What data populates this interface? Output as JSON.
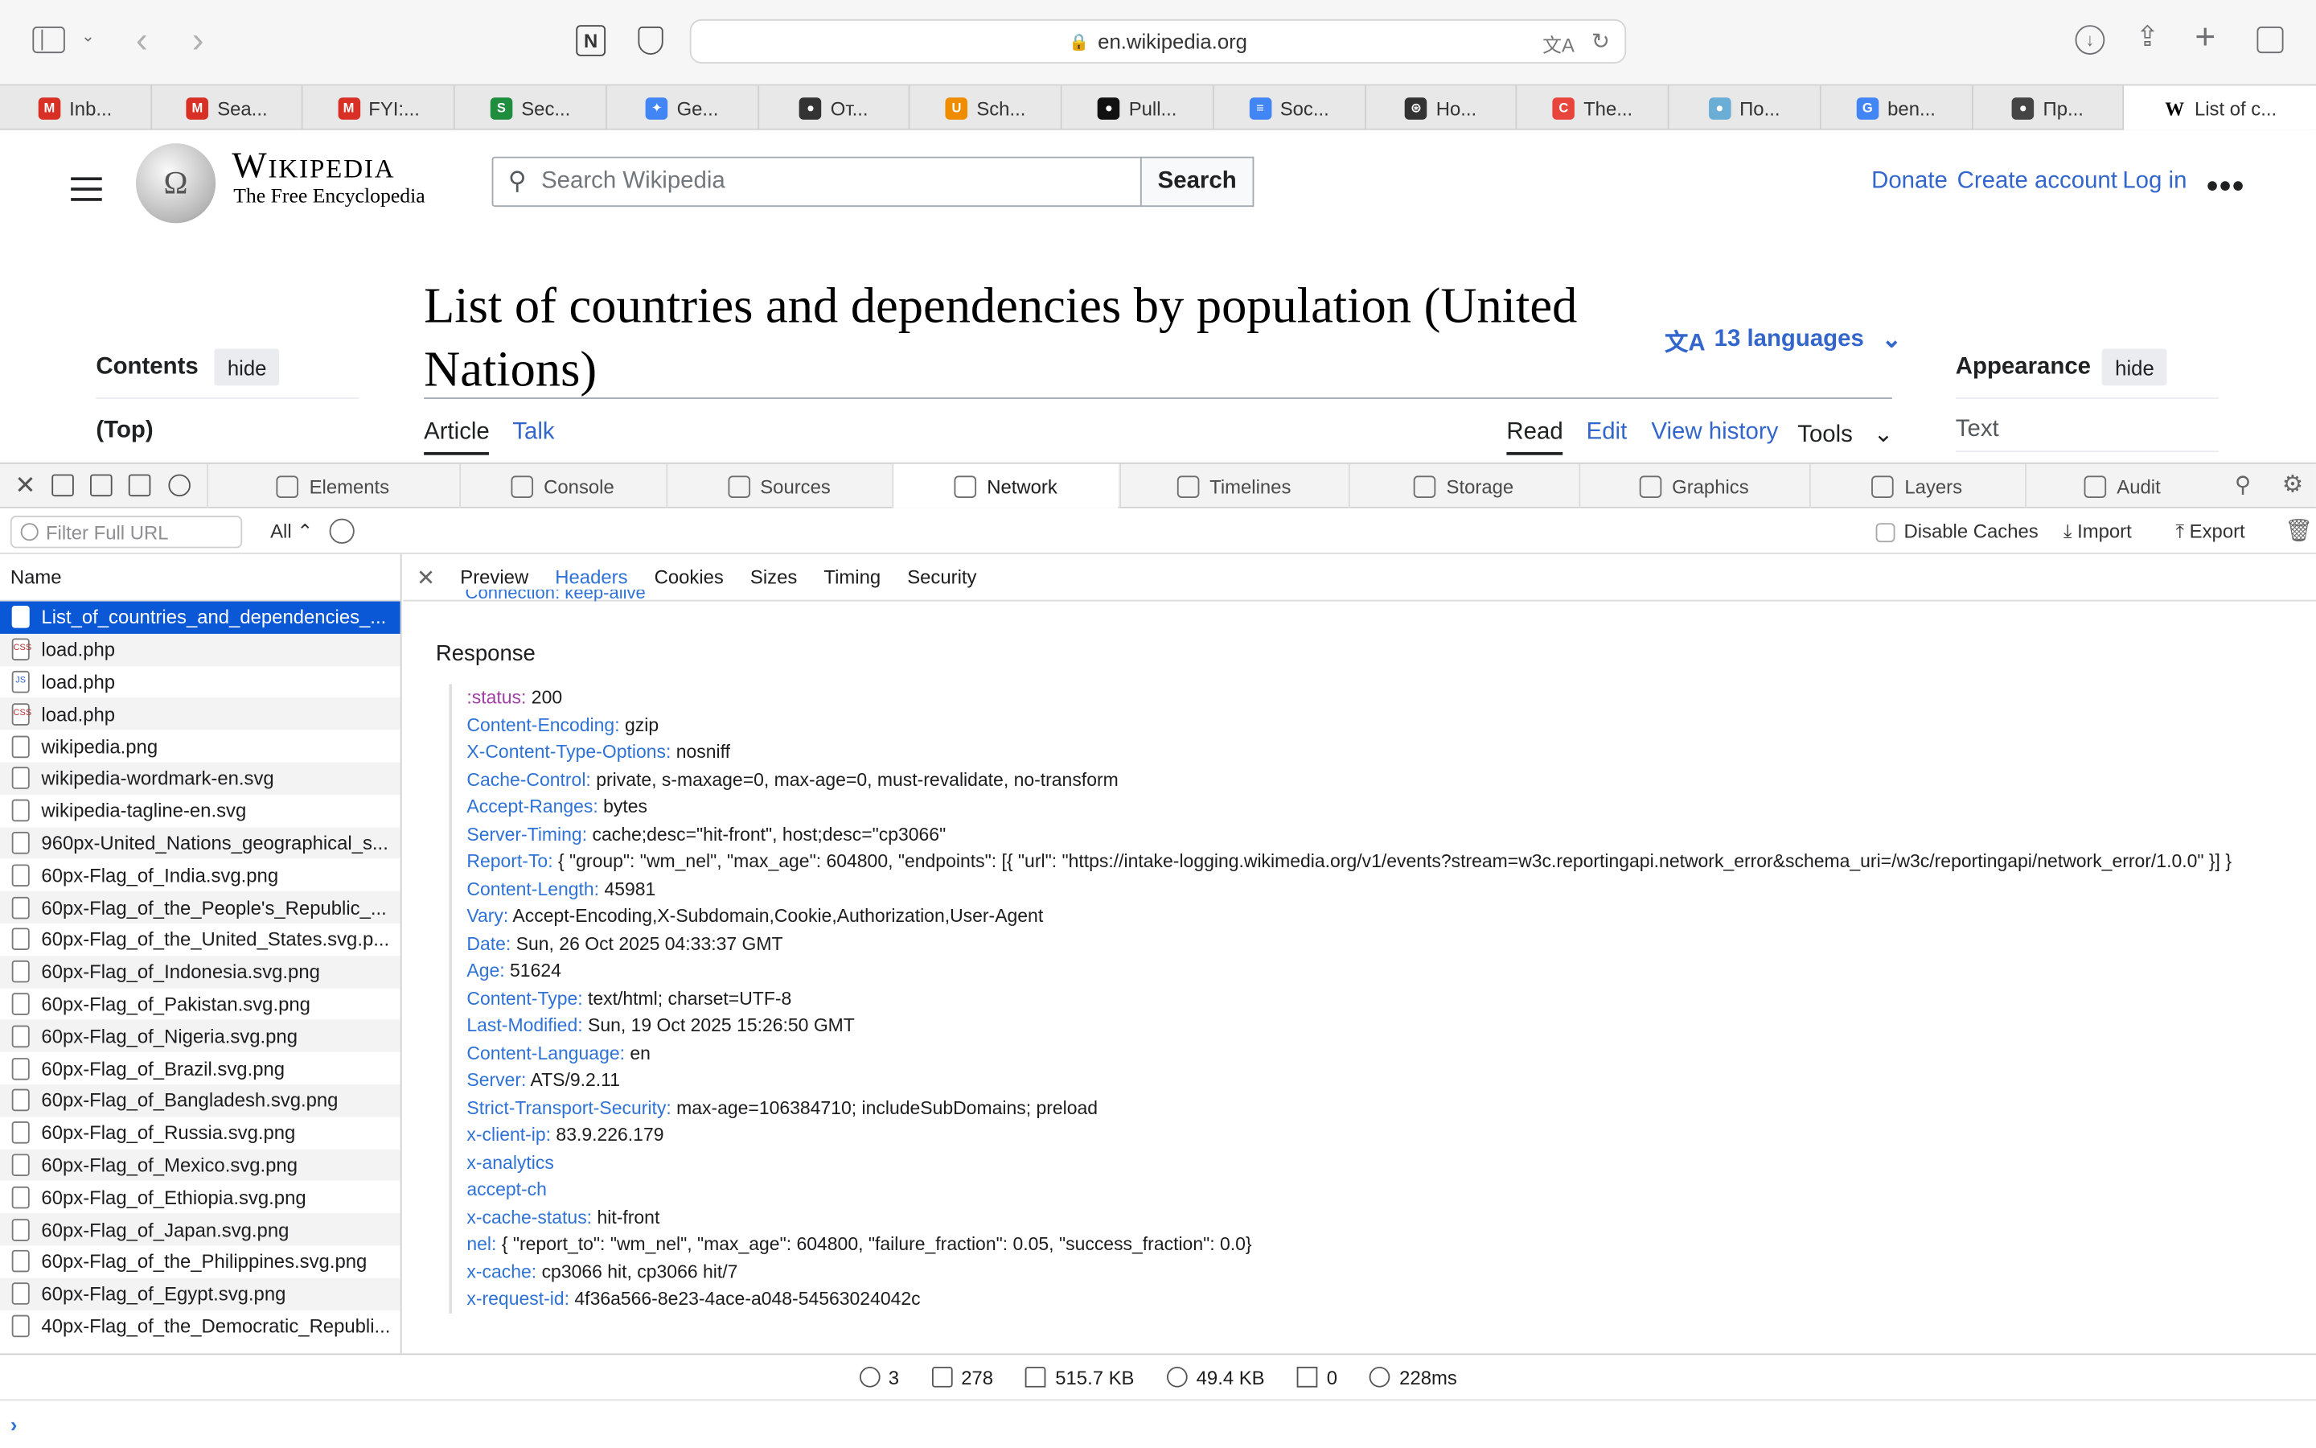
{
  "browser": {
    "url": "en.wikipedia.org"
  },
  "tabs": [
    {
      "label": "Inb...",
      "color": "#d93025",
      "glyph": "M"
    },
    {
      "label": "Sea...",
      "color": "#d93025",
      "glyph": "M"
    },
    {
      "label": "FYI:...",
      "color": "#d93025",
      "glyph": "M"
    },
    {
      "label": "Sec...",
      "color": "#1e8e3e",
      "glyph": "S"
    },
    {
      "label": "Ge...",
      "color": "#4285f4",
      "glyph": "✦"
    },
    {
      "label": "От...",
      "color": "#333333",
      "glyph": "●"
    },
    {
      "label": "Sch...",
      "color": "#f08c00",
      "glyph": "U"
    },
    {
      "label": "Pull...",
      "color": "#111111",
      "glyph": "●"
    },
    {
      "label": "Soc...",
      "color": "#4285f4",
      "glyph": "≡"
    },
    {
      "label": "Ho...",
      "color": "#333333",
      "glyph": "⊛"
    },
    {
      "label": "The...",
      "color": "#e8453c",
      "glyph": "C"
    },
    {
      "label": "По...",
      "color": "#6aaed6",
      "glyph": "●"
    },
    {
      "label": "ben...",
      "color": "#4285f4",
      "glyph": "G"
    },
    {
      "label": "Пр...",
      "color": "#444444",
      "glyph": "●"
    },
    {
      "label": "List of c...",
      "color": "#ffffff",
      "glyph": "W"
    }
  ],
  "wiki": {
    "wordmark": "Wikipedia",
    "tagline": "The Free Encyclopedia",
    "search_placeholder": "Search Wikipedia",
    "search_button": "Search",
    "donate": "Donate",
    "create_account": "Create account",
    "login": "Log in",
    "title": "List of countries and dependencies by population (United Nations)",
    "languages": "13 languages",
    "contents": "Contents",
    "hide": "hide",
    "top": "(Top)",
    "article": "Article",
    "talk": "Talk",
    "read": "Read",
    "edit": "Edit",
    "view_history": "View history",
    "tools": "Tools",
    "appearance": "Appearance",
    "text": "Text"
  },
  "devtools": {
    "tabs": [
      "Elements",
      "Console",
      "Sources",
      "Network",
      "Timelines",
      "Storage",
      "Graphics",
      "Layers",
      "Audit"
    ],
    "active_tab": "Network",
    "filter_placeholder": "Filter Full URL",
    "filter_all": "All",
    "disable_caches": "Disable Caches",
    "import": "Import",
    "export": "Export",
    "name_header": "Name",
    "files": [
      "List_of_countries_and_dependencies_...",
      "load.php",
      "load.php",
      "load.php",
      "wikipedia.png",
      "wikipedia-wordmark-en.svg",
      "wikipedia-tagline-en.svg",
      "960px-United_Nations_geographical_s...",
      "60px-Flag_of_India.svg.png",
      "60px-Flag_of_the_People's_Republic_...",
      "60px-Flag_of_the_United_States.svg.p...",
      "60px-Flag_of_Indonesia.svg.png",
      "60px-Flag_of_Pakistan.svg.png",
      "60px-Flag_of_Nigeria.svg.png",
      "60px-Flag_of_Brazil.svg.png",
      "60px-Flag_of_Bangladesh.svg.png",
      "60px-Flag_of_Russia.svg.png",
      "60px-Flag_of_Mexico.svg.png",
      "60px-Flag_of_Ethiopia.svg.png",
      "60px-Flag_of_Japan.svg.png",
      "60px-Flag_of_the_Philippines.svg.png",
      "60px-Flag_of_Egypt.svg.png",
      "40px-Flag_of_the_Democratic_Republi..."
    ],
    "detail_tabs": [
      "Preview",
      "Headers",
      "Cookies",
      "Sizes",
      "Timing",
      "Security"
    ],
    "active_detail": "Headers",
    "response_title": "Response",
    "headers": [
      {
        "k": ":status:",
        "v": "200"
      },
      {
        "k": "Content-Encoding:",
        "v": "gzip"
      },
      {
        "k": "X-Content-Type-Options:",
        "v": "nosniff"
      },
      {
        "k": "Cache-Control:",
        "v": "private, s-maxage=0, max-age=0, must-revalidate, no-transform"
      },
      {
        "k": "Accept-Ranges:",
        "v": "bytes"
      },
      {
        "k": "Server-Timing:",
        "v": "cache;desc=\"hit-front\", host;desc=\"cp3066\""
      },
      {
        "k": "Report-To:",
        "v": "{ \"group\": \"wm_nel\", \"max_age\": 604800, \"endpoints\": [{ \"url\": \"https://intake-logging.wikimedia.org/v1/events?stream=w3c.reportingapi.network_error&schema_uri=/w3c/reportingapi/network_error/1.0.0\" }] }"
      },
      {
        "k": "Content-Length:",
        "v": "45981"
      },
      {
        "k": "Vary:",
        "v": "Accept-Encoding,X-Subdomain,Cookie,Authorization,User-Agent"
      },
      {
        "k": "Date:",
        "v": "Sun, 26 Oct 2025 04:33:37 GMT"
      },
      {
        "k": "Age:",
        "v": "51624"
      },
      {
        "k": "Content-Type:",
        "v": "text/html; charset=UTF-8"
      },
      {
        "k": "Last-Modified:",
        "v": "Sun, 19 Oct 2025 15:26:50 GMT"
      },
      {
        "k": "Content-Language:",
        "v": "en"
      },
      {
        "k": "Server:",
        "v": "ATS/9.2.11"
      },
      {
        "k": "Strict-Transport-Security:",
        "v": "max-age=106384710; includeSubDomains; preload"
      },
      {
        "k": "x-client-ip:",
        "v": "83.9.226.179"
      },
      {
        "k": "x-analytics",
        "v": ""
      },
      {
        "k": "accept-ch",
        "v": ""
      },
      {
        "k": "x-cache-status:",
        "v": "hit-front"
      },
      {
        "k": "nel:",
        "v": "{ \"report_to\": \"wm_nel\", \"max_age\": 604800, \"failure_fraction\": 0.05, \"success_fraction\": 0.0}"
      },
      {
        "k": "x-cache:",
        "v": "cp3066 hit, cp3066 hit/7"
      },
      {
        "k": "x-request-id:",
        "v": "4f36a566-8e23-4ace-a048-54563024042c"
      }
    ],
    "status": {
      "requests": "3",
      "resources": "278",
      "size": "515.7 KB",
      "transferred": "49.4 KB",
      "errors": "0",
      "time": "228ms"
    }
  }
}
